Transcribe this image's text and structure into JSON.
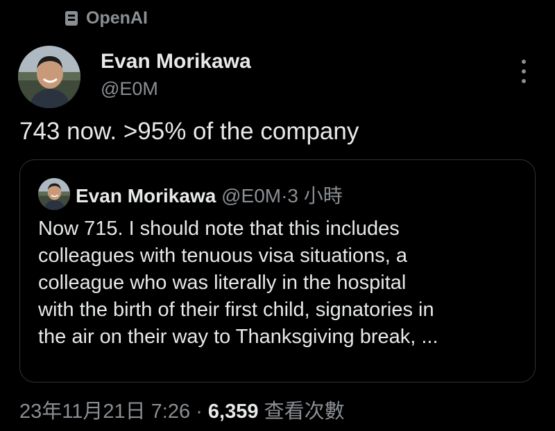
{
  "context": {
    "label": "OpenAI"
  },
  "author": {
    "name": "Evan Morikawa",
    "handle": "@E0M"
  },
  "tweet": {
    "text": "743 now. >95% of the company"
  },
  "quote": {
    "name": "Evan Morikawa",
    "handle": "@E0M",
    "separator": "·",
    "time": "3 小時",
    "lines": [
      "Now 715. I should note that this includes",
      "colleagues with tenuous visa situations, a",
      "colleague who was literally in the hospital",
      "with the birth of their first child, signatories in",
      "the air on their way to Thanksgiving break, ..."
    ]
  },
  "footer": {
    "datetime": "23年11月21日 7:26",
    "separator": "·",
    "views_count": "6,359",
    "views_label": "查看次數"
  },
  "icons": {
    "context": "list-icon",
    "more": "more-options-icon"
  }
}
